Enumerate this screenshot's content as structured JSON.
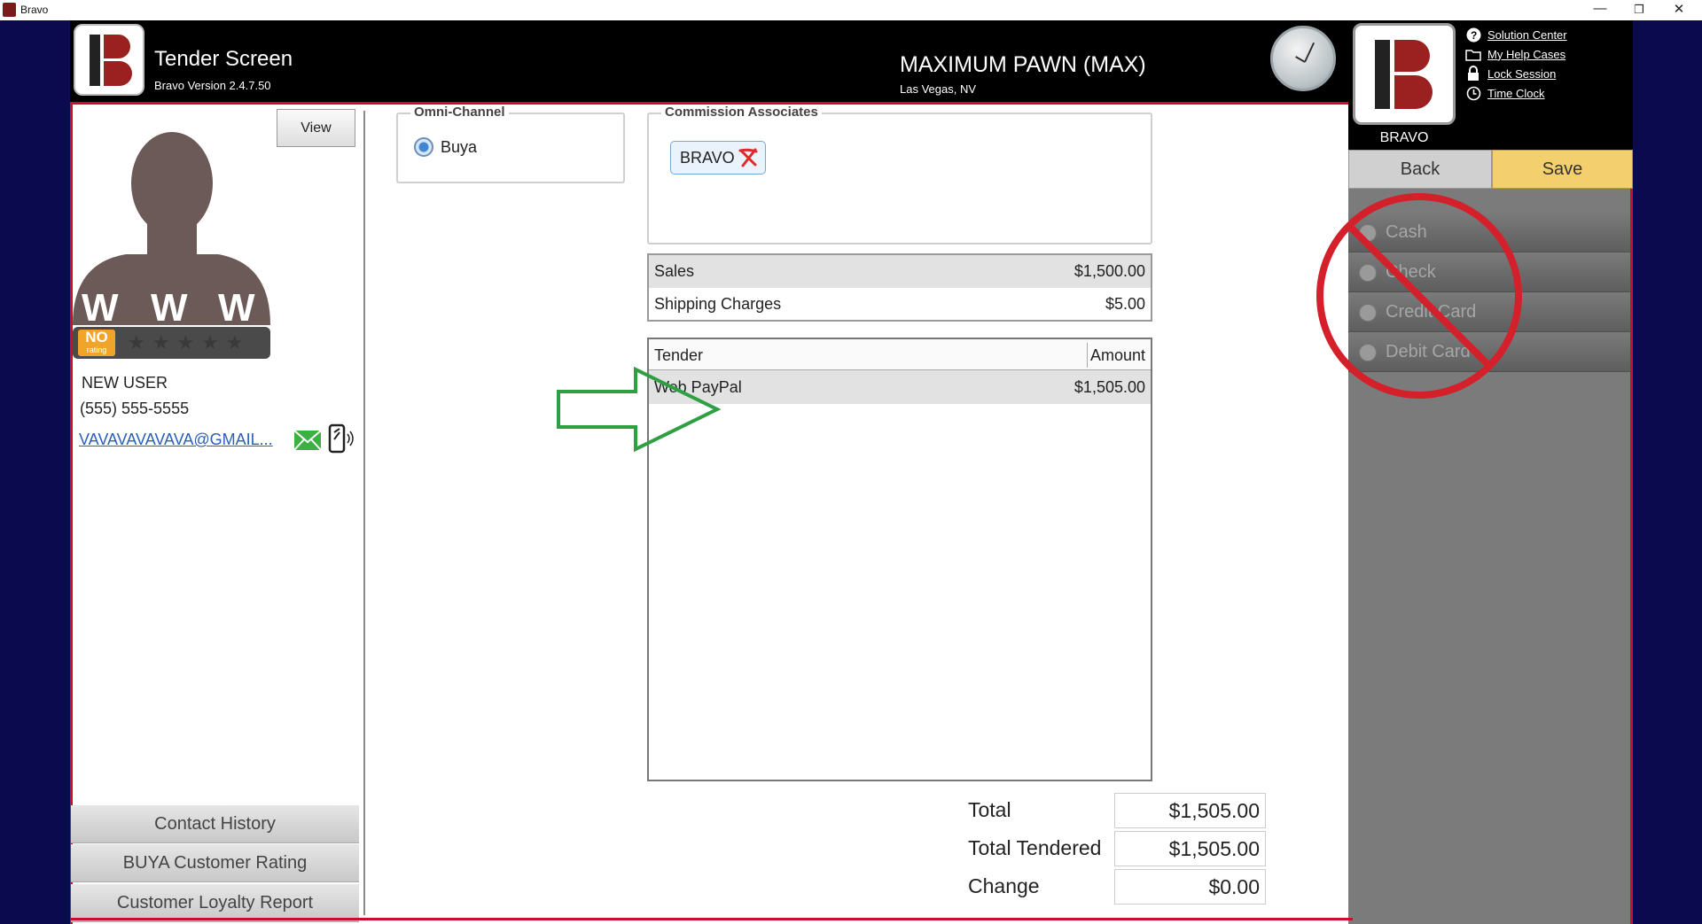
{
  "window": {
    "title": "Bravo",
    "minimize": "—",
    "restore": "❐",
    "close": "✕"
  },
  "header": {
    "screen_title": "Tender Screen",
    "version": "Bravo Version 2.4.7.50",
    "store_name": "MAXIMUM PAWN (MAX)",
    "store_location": "Las Vegas, NV"
  },
  "user_panel": {
    "username": "BRAVO",
    "links": [
      {
        "label": "Solution Center",
        "icon": "question-icon"
      },
      {
        "label": "My Help Cases",
        "icon": "folder-icon"
      },
      {
        "label": "Lock Session",
        "icon": "lock-icon"
      },
      {
        "label": "Time Clock",
        "icon": "clock-icon"
      }
    ],
    "back_label": "Back",
    "save_label": "Save",
    "payment_options": [
      "Cash",
      "Check",
      "Credit Card",
      "Debit Card"
    ]
  },
  "customer": {
    "view_label": "View",
    "rating_badge": "NO",
    "rating_sub": "rating",
    "stars": "★★★★★",
    "name": "NEW USER",
    "phone": "(555) 555-5555",
    "email": "VAVAVAVAVAVA@GMAIL...",
    "buttons": [
      "Contact History",
      "BUYA Customer Rating",
      "Customer Loyalty Report"
    ]
  },
  "omni_channel": {
    "legend": "Omni-Channel",
    "option": "Buya"
  },
  "commission": {
    "legend": "Commission Associates",
    "associate": "BRAVO"
  },
  "summary": {
    "rows": [
      {
        "label": "Sales",
        "value": "$1,500.00"
      },
      {
        "label": "Shipping Charges",
        "value": "$5.00"
      }
    ]
  },
  "tender_table": {
    "headers": {
      "tender": "Tender",
      "amount": "Amount"
    },
    "rows": [
      {
        "tender": "Web PayPal",
        "amount": "$1,505.00"
      }
    ]
  },
  "totals": {
    "total_label": "Total",
    "total_value": "$1,505.00",
    "tendered_label": "Total Tendered",
    "tendered_value": "$1,505.00",
    "change_label": "Change",
    "change_value": "$0.00"
  },
  "colors": {
    "accent_red": "#c8102e",
    "save_yellow": "#f3cf6e",
    "arrow_green": "#2ea043",
    "link_blue": "#2b5fb8"
  }
}
